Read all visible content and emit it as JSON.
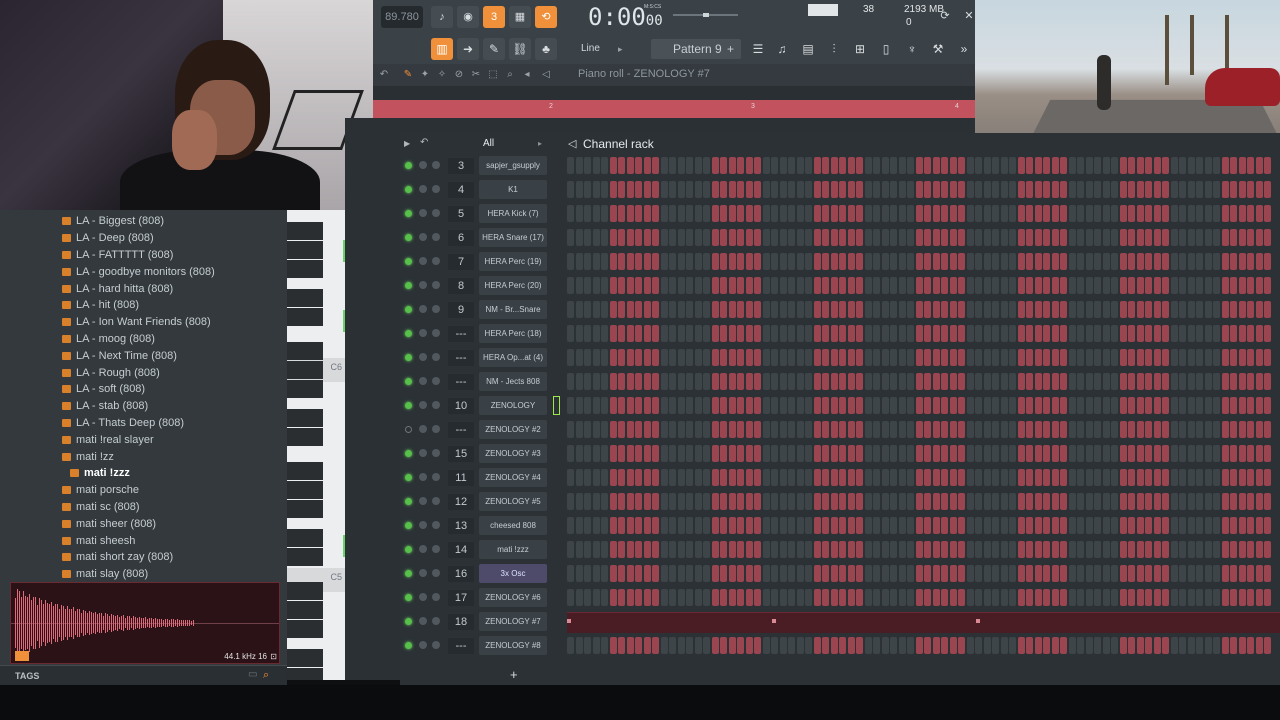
{
  "toolbar": {
    "tempo": "89.780",
    "time_main": "0:00",
    "time_small": "00",
    "time_unit_label": "M:S:CS",
    "cpu_value": "38",
    "memory_value": "2193 MB",
    "polyphony_value": "0",
    "snap_label": "Line",
    "pattern_label": "Pattern 9",
    "pattern_add": "+",
    "piano_roll_title": "Piano roll - ZENOLOGY #7"
  },
  "ruler": {
    "markers": [
      "2",
      "3",
      "4"
    ]
  },
  "browser": {
    "items": [
      {
        "label": "LA - Biggest (808)",
        "indent": 0,
        "selected": false
      },
      {
        "label": "LA - Deep (808)",
        "indent": 0,
        "selected": false
      },
      {
        "label": "LA - FATTTTT (808)",
        "indent": 0,
        "selected": false
      },
      {
        "label": "LA - goodbye monitors (808)",
        "indent": 0,
        "selected": false
      },
      {
        "label": "LA - hard hitta (808)",
        "indent": 0,
        "selected": false
      },
      {
        "label": "LA - hit (808)",
        "indent": 0,
        "selected": false
      },
      {
        "label": "LA - Ion Want Friends (808)",
        "indent": 0,
        "selected": false
      },
      {
        "label": "LA - moog (808)",
        "indent": 0,
        "selected": false
      },
      {
        "label": "LA - Next Time (808)",
        "indent": 0,
        "selected": false
      },
      {
        "label": "LA - Rough (808)",
        "indent": 0,
        "selected": false
      },
      {
        "label": "LA - soft (808)",
        "indent": 0,
        "selected": false
      },
      {
        "label": "LA - stab (808)",
        "indent": 0,
        "selected": false
      },
      {
        "label": "LA - Thats Deep (808)",
        "indent": 0,
        "selected": false
      },
      {
        "label": "mati !real slayer",
        "indent": 0,
        "selected": false
      },
      {
        "label": "mati !zz",
        "indent": 0,
        "selected": false
      },
      {
        "label": "mati !zzz",
        "indent": 1,
        "selected": true
      },
      {
        "label": "mati porsche",
        "indent": 0,
        "selected": false
      },
      {
        "label": "mati sc (808)",
        "indent": 0,
        "selected": false
      },
      {
        "label": "mati sheer (808)",
        "indent": 0,
        "selected": false
      },
      {
        "label": "mati sheesh",
        "indent": 0,
        "selected": false
      },
      {
        "label": "mati short zay (808)",
        "indent": 0,
        "selected": false
      },
      {
        "label": "mati slay (808)",
        "indent": 0,
        "selected": false
      }
    ],
    "sample_info": "44.1 kHz 16",
    "tags_label": "TAGS"
  },
  "piano": {
    "labels": [
      "C6",
      "C5"
    ]
  },
  "rack": {
    "title": "Channel rack",
    "filter": "All",
    "add_label": "+",
    "channels": [
      {
        "mixer": "3",
        "name": "sapjer_gsupply",
        "led": true,
        "highlight": false,
        "roll": false
      },
      {
        "mixer": "4",
        "name": "K1",
        "led": true,
        "highlight": false,
        "roll": false
      },
      {
        "mixer": "5",
        "name": "HERA Kick (7)",
        "led": true,
        "highlight": false,
        "roll": false
      },
      {
        "mixer": "6",
        "name": "HERA Snare (17)",
        "led": true,
        "highlight": false,
        "roll": false
      },
      {
        "mixer": "7",
        "name": "HERA Perc (19)",
        "led": true,
        "highlight": false,
        "roll": false
      },
      {
        "mixer": "8",
        "name": "HERA Perc (20)",
        "led": true,
        "highlight": false,
        "roll": false
      },
      {
        "mixer": "9",
        "name": "NM - Br...Snare",
        "led": true,
        "highlight": false,
        "roll": false
      },
      {
        "mixer": "---",
        "name": "HERA Perc (18)",
        "led": true,
        "highlight": false,
        "roll": false
      },
      {
        "mixer": "---",
        "name": "HERA Op...at (4)",
        "led": true,
        "highlight": false,
        "roll": false
      },
      {
        "mixer": "---",
        "name": "NM - Jects 808",
        "led": true,
        "highlight": false,
        "roll": false
      },
      {
        "mixer": "10",
        "name": "ZENOLOGY",
        "led": true,
        "highlight": false,
        "roll": false,
        "selected": true
      },
      {
        "mixer": "---",
        "name": "ZENOLOGY #2",
        "led": false,
        "highlight": false,
        "roll": false
      },
      {
        "mixer": "15",
        "name": "ZENOLOGY #3",
        "led": true,
        "highlight": false,
        "roll": false
      },
      {
        "mixer": "11",
        "name": "ZENOLOGY #4",
        "led": true,
        "highlight": false,
        "roll": false
      },
      {
        "mixer": "12",
        "name": "ZENOLOGY #5",
        "led": true,
        "highlight": false,
        "roll": false
      },
      {
        "mixer": "13",
        "name": "cheesed 808",
        "led": true,
        "highlight": false,
        "roll": false
      },
      {
        "mixer": "14",
        "name": "mati !zzz",
        "led": true,
        "highlight": false,
        "roll": false
      },
      {
        "mixer": "16",
        "name": "3x Osc",
        "led": true,
        "highlight": true,
        "roll": false
      },
      {
        "mixer": "17",
        "name": "ZENOLOGY #6",
        "led": true,
        "highlight": false,
        "roll": false
      },
      {
        "mixer": "18",
        "name": "ZENOLOGY #7",
        "led": true,
        "highlight": false,
        "roll": true
      },
      {
        "mixer": "---",
        "name": "ZENOLOGY #8",
        "led": true,
        "highlight": false,
        "roll": false
      }
    ],
    "step_pattern": "GGGGGRRRRRRGGGGGGRRRRRRGGGGGGRRRRRRGGGGGGRRRRRRGGGGGGRRRRRRGGGGGGRRRRRRGGGGGGRRRRRR"
  },
  "colors": {
    "accent": "#f0903a",
    "step_on": "#9a4550",
    "step_off": "#3d4549",
    "led": "#57c04a"
  },
  "icons": {
    "webcam": "webcam-feed",
    "game": "game-stream"
  }
}
